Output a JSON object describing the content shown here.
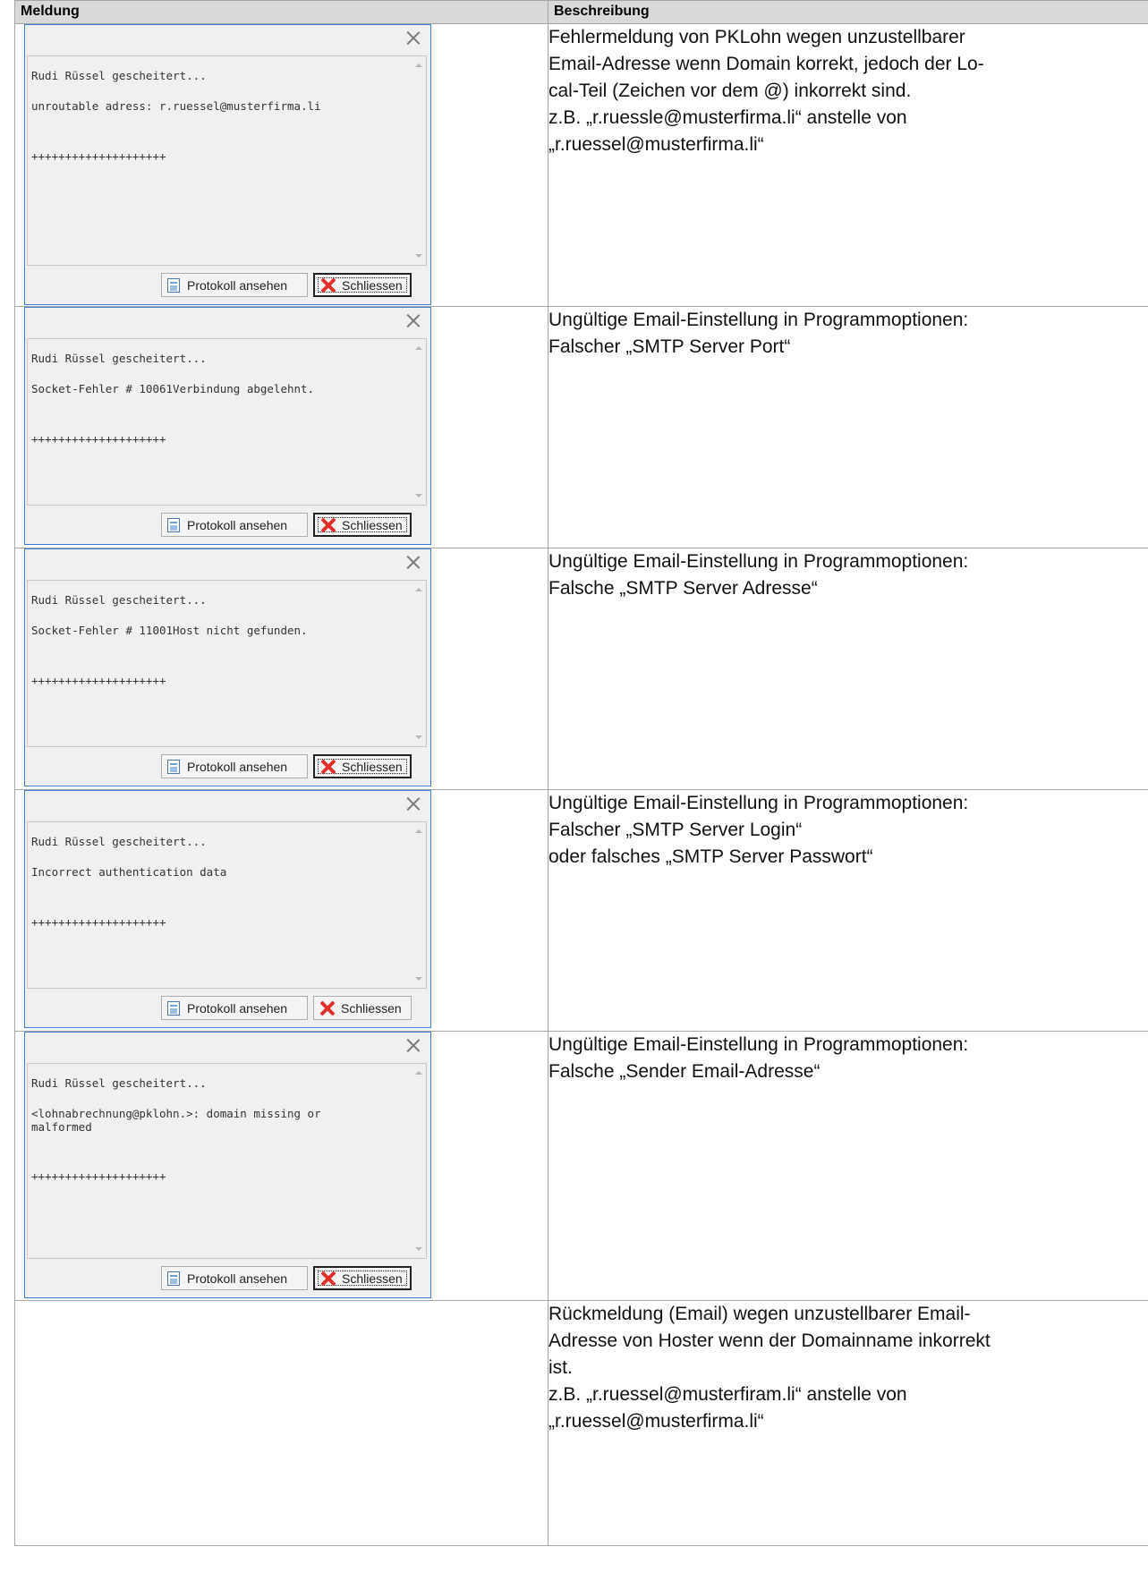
{
  "table": {
    "headers": [
      "Meldung",
      "Beschreibung"
    ],
    "rows": [
      {
        "dialog": {
          "log_lines": [
            "Rudi Rüssel gescheitert...",
            "unroutable adress: r.ruessel@musterfirma.li",
            "",
            "++++++++++++++++++++"
          ],
          "protokoll_label": "Protokoll ansehen",
          "schliessen_label": "Schliessen",
          "schliessen_focused": true
        },
        "description": [
          "Fehlermeldung von PKLohn wegen unzustellbarer",
          "Email-Adresse wenn Domain korrekt, jedoch der Lo-",
          "cal-Teil (Zeichen vor dem @) inkorrekt sind.",
          "z.B. „r.ruessle@musterfirma.li“ anstelle von",
          "„r.ruessel@musterfirma.li“"
        ]
      },
      {
        "dialog": {
          "log_lines": [
            "Rudi Rüssel gescheitert...",
            "Socket-Fehler # 10061Verbindung abgelehnt.",
            "",
            "++++++++++++++++++++"
          ],
          "protokoll_label": "Protokoll ansehen",
          "schliessen_label": "Schliessen",
          "schliessen_focused": true
        },
        "description": [
          "Ungültige Email-Einstellung in Programmoptionen:",
          "Falscher „SMTP Server Port“"
        ]
      },
      {
        "dialog": {
          "log_lines": [
            "Rudi Rüssel gescheitert...",
            "Socket-Fehler # 11001Host nicht gefunden.",
            "",
            "++++++++++++++++++++"
          ],
          "protokoll_label": "Protokoll ansehen",
          "schliessen_label": "Schliessen",
          "schliessen_focused": true
        },
        "description": [
          "Ungültige Email-Einstellung in Programmoptionen:",
          "Falsche „SMTP Server Adresse“"
        ]
      },
      {
        "dialog": {
          "log_lines": [
            "Rudi Rüssel gescheitert...",
            "Incorrect authentication data",
            "",
            "++++++++++++++++++++"
          ],
          "protokoll_label": "Protokoll ansehen",
          "schliessen_label": "Schliessen",
          "schliessen_focused": false
        },
        "description": [
          "Ungültige Email-Einstellung in Programmoptionen:",
          "Falscher „SMTP Server Login“",
          "oder falsches „SMTP Server Passwort“"
        ]
      },
      {
        "dialog": {
          "log_lines": [
            "Rudi Rüssel gescheitert...",
            "<lohnabrechnung@pklohn.>: domain missing or",
            "malformed",
            "",
            "++++++++++++++++++++"
          ],
          "protokoll_label": "Protokoll ansehen",
          "schliessen_label": "Schliessen",
          "schliessen_focused": true
        },
        "description": [
          "Ungültige Email-Einstellung in Programmoptionen:",
          "Falsche „Sender Email-Adresse“"
        ]
      },
      {
        "dialog": null,
        "description": [
          "Rückmeldung (Email) wegen unzustellbarer Email-",
          "Adresse von Hoster wenn der Domainname inkorrekt",
          "ist.",
          "z.B. „r.ruessel@musterfiram.li“ anstelle von",
          "„r.ruessel@musterfirma.li“"
        ]
      }
    ]
  },
  "icons": {
    "close": "close-icon",
    "protokoll": "log-document-icon",
    "schliessen": "red-x-icon"
  },
  "colors": {
    "dialog_border": "#3c7fcf",
    "header_bg": "#d9d9d9",
    "close_red": "#e0302b"
  }
}
